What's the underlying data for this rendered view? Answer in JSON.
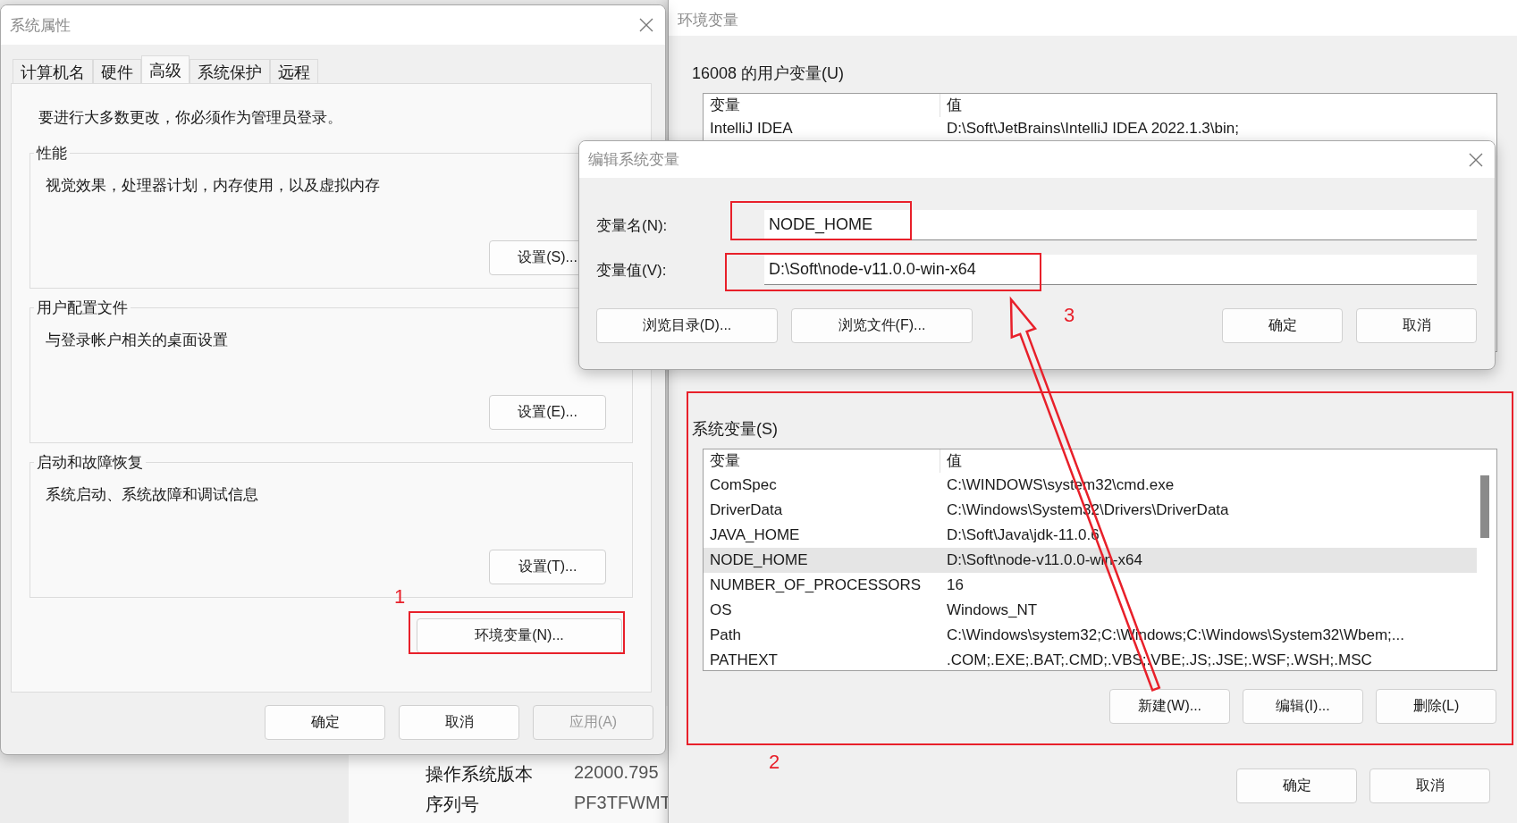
{
  "background_window": {
    "rows": [
      {
        "label": "操作系统版本",
        "value": "22000.795"
      },
      {
        "label": "序列号",
        "value": "PF3TFWMT"
      }
    ]
  },
  "system_properties": {
    "title": "系统属性",
    "tabs": [
      {
        "label": "计算机名",
        "selected": false
      },
      {
        "label": "硬件",
        "selected": false
      },
      {
        "label": "高级",
        "selected": true
      },
      {
        "label": "系统保护",
        "selected": false
      },
      {
        "label": "远程",
        "selected": false
      }
    ],
    "admin_note": "要进行大多数更改，你必须作为管理员登录。",
    "groups": [
      {
        "title": "性能",
        "description": "视觉效果，处理器计划，内存使用，以及虚拟内存",
        "button": "设置(S)..."
      },
      {
        "title": "用户配置文件",
        "description": "与登录帐户相关的桌面设置",
        "button": "设置(E)..."
      },
      {
        "title": "启动和故障恢复",
        "description": "系统启动、系统故障和调试信息",
        "button": "设置(T)..."
      }
    ],
    "env_button": "环境变量(N)...",
    "buttons": [
      {
        "label": "确定",
        "disabled": false
      },
      {
        "label": "取消",
        "disabled": false
      },
      {
        "label": "应用(A)",
        "disabled": true
      }
    ]
  },
  "environment_variables": {
    "title": "环境变量",
    "user_section": {
      "title": "16008 的用户变量(U)",
      "columns": [
        "变量",
        "值"
      ],
      "rows": [
        {
          "name": "IntelliJ IDEA",
          "value": "D:\\Soft\\JetBrains\\IntelliJ IDEA 2022.1.3\\bin;",
          "selected": false
        }
      ]
    },
    "system_section": {
      "title": "系统变量(S)",
      "columns": [
        "变量",
        "值"
      ],
      "rows": [
        {
          "name": "ComSpec",
          "value": "C:\\WINDOWS\\system32\\cmd.exe",
          "selected": false
        },
        {
          "name": "DriverData",
          "value": "C:\\Windows\\System32\\Drivers\\DriverData",
          "selected": false
        },
        {
          "name": "JAVA_HOME",
          "value": "D:\\Soft\\Java\\jdk-11.0.6",
          "selected": false
        },
        {
          "name": "NODE_HOME",
          "value": "D:\\Soft\\node-v11.0.0-win-x64",
          "selected": true
        },
        {
          "name": "NUMBER_OF_PROCESSORS",
          "value": "16",
          "selected": false
        },
        {
          "name": "OS",
          "value": "Windows_NT",
          "selected": false
        },
        {
          "name": "Path",
          "value": "C:\\Windows\\system32;C:\\Windows;C:\\Windows\\System32\\Wbem;...",
          "selected": false
        },
        {
          "name": "PATHEXT",
          "value": ".COM;.EXE;.BAT;.CMD;.VBS;.VBE;.JS;.JSE;.WSF;.WSH;.MSC",
          "selected": false
        }
      ],
      "buttons": [
        "新建(W)...",
        "编辑(I)...",
        "删除(L)"
      ]
    },
    "buttons": [
      "确定",
      "取消"
    ]
  },
  "edit_dialog": {
    "title": "编辑系统变量",
    "fields": [
      {
        "label": "变量名(N):",
        "value": "NODE_HOME"
      },
      {
        "label": "变量值(V):",
        "value": "D:\\Soft\\node-v11.0.0-win-x64"
      }
    ],
    "buttons": [
      "浏览目录(D)...",
      "浏览文件(F)..."
    ],
    "actions": [
      "确定",
      "取消"
    ]
  },
  "annotations": [
    {
      "label": "1"
    },
    {
      "label": "2"
    },
    {
      "label": "3"
    }
  ]
}
